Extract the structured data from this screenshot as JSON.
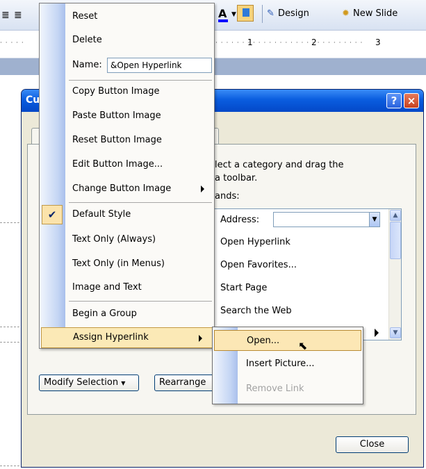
{
  "toolbar": {
    "design_label": "Design",
    "new_slide_label": "New Slide"
  },
  "ruler": {
    "marks": [
      "1",
      "2",
      "3"
    ]
  },
  "dialog": {
    "title_fragment": "Cu",
    "help_button": "?",
    "close_glyph": "×",
    "instruction_line1": "lect a category and drag the",
    "instruction_line2": "a toolbar.",
    "commands_label": "ands:",
    "commands": {
      "address_label": "Address:",
      "items": [
        "Open Hyperlink",
        "Open Favorites...",
        "Start Page",
        "Search the Web"
      ]
    },
    "modify_selection_label": "Modify Selection",
    "rearrange_label": "Rearrange",
    "close_label": "Close"
  },
  "context_menu": {
    "reset": "Reset",
    "delete": "Delete",
    "name_label": "Name:",
    "name_value": "&Open Hyperlink",
    "copy_image": "Copy Button Image",
    "paste_image": "Paste Button Image",
    "reset_image": "Reset Button Image",
    "edit_image": "Edit Button Image...",
    "change_image": "Change Button Image",
    "default_style": "Default Style",
    "text_only_always": "Text Only (Always)",
    "text_only_menus": "Text Only (in Menus)",
    "image_and_text": "Image and Text",
    "begin_group": "Begin a Group",
    "assign_hyperlink": "Assign Hyperlink"
  },
  "submenu": {
    "open": "Open...",
    "insert_picture": "Insert Picture...",
    "remove_link": "Remove Link"
  },
  "colors": {
    "menu_highlight": "#fbe9b6",
    "title_bar": "#0a5ddf",
    "gutter": "#c5d6f4"
  }
}
